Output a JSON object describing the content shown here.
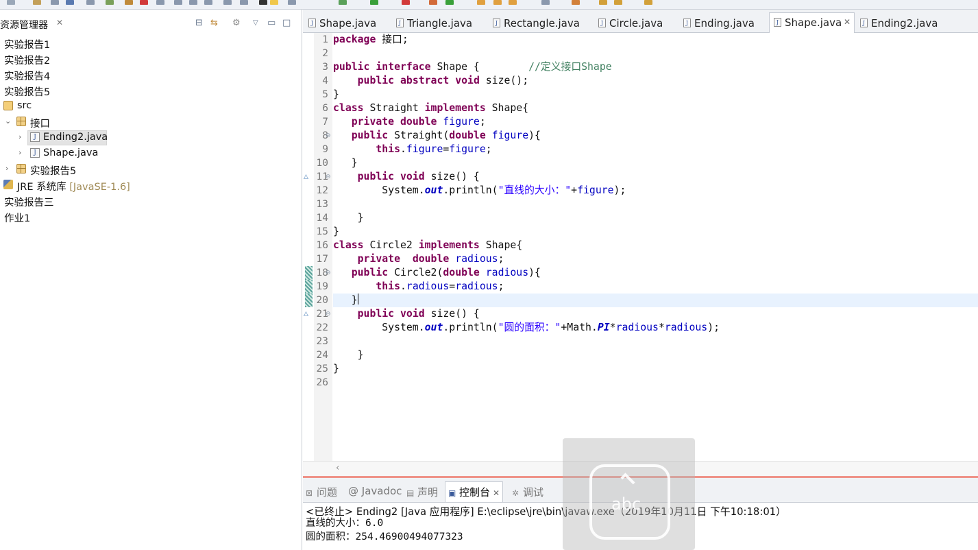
{
  "explorer": {
    "title": "资源管理器",
    "close_glyph": "✕",
    "tree": [
      {
        "label": "实验报告1"
      },
      {
        "label": "实验报告2"
      },
      {
        "label": "实验报告4"
      },
      {
        "label": "实验报告5"
      },
      {
        "label": "src"
      },
      {
        "label": "接口"
      },
      {
        "label": "Ending2.java"
      },
      {
        "label": "Shape.java"
      },
      {
        "label": "实验报告5"
      },
      {
        "label": "JRE 系统库",
        "decoration": "[JavaSE-1.6]"
      },
      {
        "label": "实验报告三"
      },
      {
        "label": "作业1"
      }
    ]
  },
  "editor_tabs": [
    {
      "label": "Shape.java"
    },
    {
      "label": "Triangle.java"
    },
    {
      "label": "Rectangle.java"
    },
    {
      "label": "Circle.java"
    },
    {
      "label": "Ending.java"
    },
    {
      "label": "Shape.java",
      "active": true
    },
    {
      "label": "Ending2.java"
    }
  ],
  "code": {
    "line_numbers": [
      "1",
      "2",
      "3",
      "4",
      "5",
      "6",
      "7",
      "8",
      "9",
      "10",
      "11",
      "12",
      "13",
      "14",
      "15",
      "16",
      "17",
      "18",
      "19",
      "20",
      "21",
      "22",
      "23",
      "24",
      "25",
      "26"
    ],
    "current_line": 20,
    "lines": [
      "package 接口;",
      "",
      "public interface Shape {        //定义接口Shape",
      "    public abstract void size();",
      "}",
      "class Straight implements Shape{",
      "   private double figure;",
      "   public Straight(double figure){",
      "       this.figure=figure;",
      "   }",
      "    public void size() {",
      "        System.out.println(\"直线的大小：\"+figure);",
      "",
      "    }",
      "}",
      "class Circle2 implements Shape{",
      "    private  double radious;",
      "   public Circle2(double radious){",
      "       this.radious=radious;",
      "   }",
      "    public void size() {",
      "        System.out.println(\"圆的面积：\"+Math.PI*radious*radious);",
      "",
      "    }",
      "}",
      ""
    ]
  },
  "bottom_tabs": [
    {
      "label": "问题",
      "icon": "problems-icon"
    },
    {
      "label": "@ Javadoc",
      "icon": "javadoc-icon"
    },
    {
      "label": "声明",
      "icon": "declaration-icon"
    },
    {
      "label": "控制台",
      "icon": "console-icon",
      "active": true
    },
    {
      "label": "调试",
      "icon": "debug-icon"
    }
  ],
  "console": {
    "header": "<已终止> Ending2 [Java 应用程序] E:\\eclipse\\jre\\bin\\javaw.exe（2019年10月11日 下午10:18:01）",
    "output": [
      "直线的大小：6.0",
      "圆的面积：254.46900494077323"
    ]
  },
  "ime_overlay": {
    "text": "abc"
  },
  "colors": {
    "keyword": "#7f0055",
    "field": "#0000c0",
    "string": "#2a00ff",
    "comment": "#3f7f5f",
    "current_line": "#e8f2fe"
  }
}
